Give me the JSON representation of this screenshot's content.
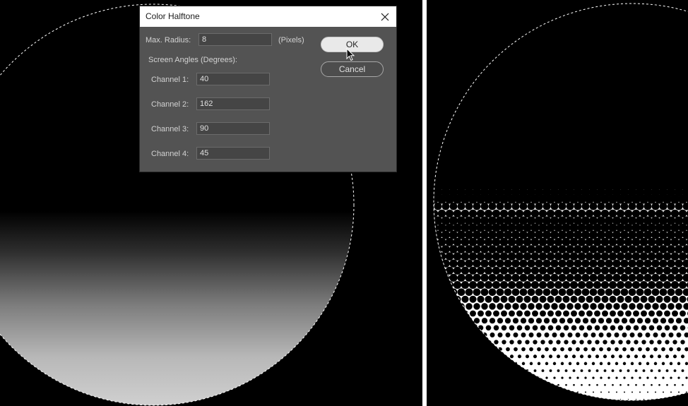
{
  "dialog": {
    "title": "Color Halftone",
    "max_radius_label": "Max. Radius:",
    "max_radius_value": "8",
    "pixels_unit": "(Pixels)",
    "screen_angles_label": "Screen Angles (Degrees):",
    "channels": [
      {
        "label": "Channel 1:",
        "value": "40"
      },
      {
        "label": "Channel 2:",
        "value": "162"
      },
      {
        "label": "Channel 3:",
        "value": "90"
      },
      {
        "label": "Channel 4:",
        "value": "45"
      }
    ],
    "ok_label": "OK",
    "cancel_label": "Cancel"
  },
  "icons": {
    "close": "close-icon",
    "cursor": "arrow-cursor-icon"
  },
  "colors": {
    "canvas_background": "#000000",
    "dialog_background": "#535353",
    "titlebar_background": "#ffffff",
    "field_background": "#454545",
    "ok_button_background": "#e9e9e9"
  }
}
